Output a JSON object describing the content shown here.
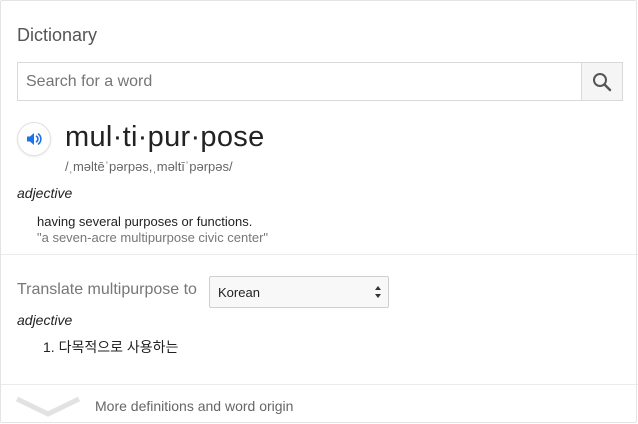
{
  "header": {
    "title": "Dictionary"
  },
  "search": {
    "placeholder": "Search for a word"
  },
  "entry": {
    "headword": "mul·ti·pur·pose",
    "pronunciation": "/ˌməltēˈpərpəs,ˌməltīˈpərpəs/",
    "part_of_speech": "adjective",
    "definition": "having several purposes or functions.",
    "example": "\"a seven-acre multipurpose civic center\""
  },
  "translate": {
    "label": "Translate multipurpose to",
    "selected_language": "Korean",
    "part_of_speech": "adjective",
    "items": [
      "1. 다목적으로 사용하는"
    ]
  },
  "footer": {
    "more_label": "More definitions and word origin"
  },
  "colors": {
    "accent_blue": "#1a73e8",
    "muted_text": "#777777",
    "border": "#d9d9d9"
  },
  "icons": {
    "search": "search-icon",
    "speaker": "speaker-icon",
    "expand": "chevron-down-icon",
    "select_arrows": "updown-arrows-icon"
  }
}
